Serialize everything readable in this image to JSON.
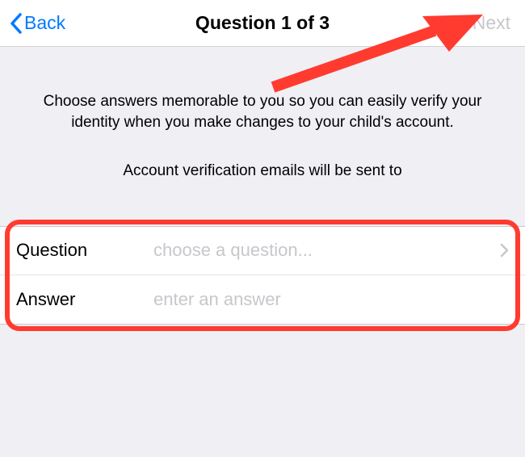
{
  "nav": {
    "back_label": "Back",
    "title": "Question 1 of 3",
    "next_label": "Next"
  },
  "content": {
    "instruction": "Choose answers memorable to you so you can easily verify your identity when you make changes to your child's account.",
    "verification_note": "Account verification emails will be sent to"
  },
  "form": {
    "question": {
      "label": "Question",
      "placeholder": "choose a question..."
    },
    "answer": {
      "label": "Answer",
      "placeholder": "enter an answer"
    }
  },
  "colors": {
    "ios_blue": "#007aff",
    "annotation_red": "#ff3b30",
    "placeholder_gray": "#c7c7cc",
    "bg": "#efeff4"
  }
}
